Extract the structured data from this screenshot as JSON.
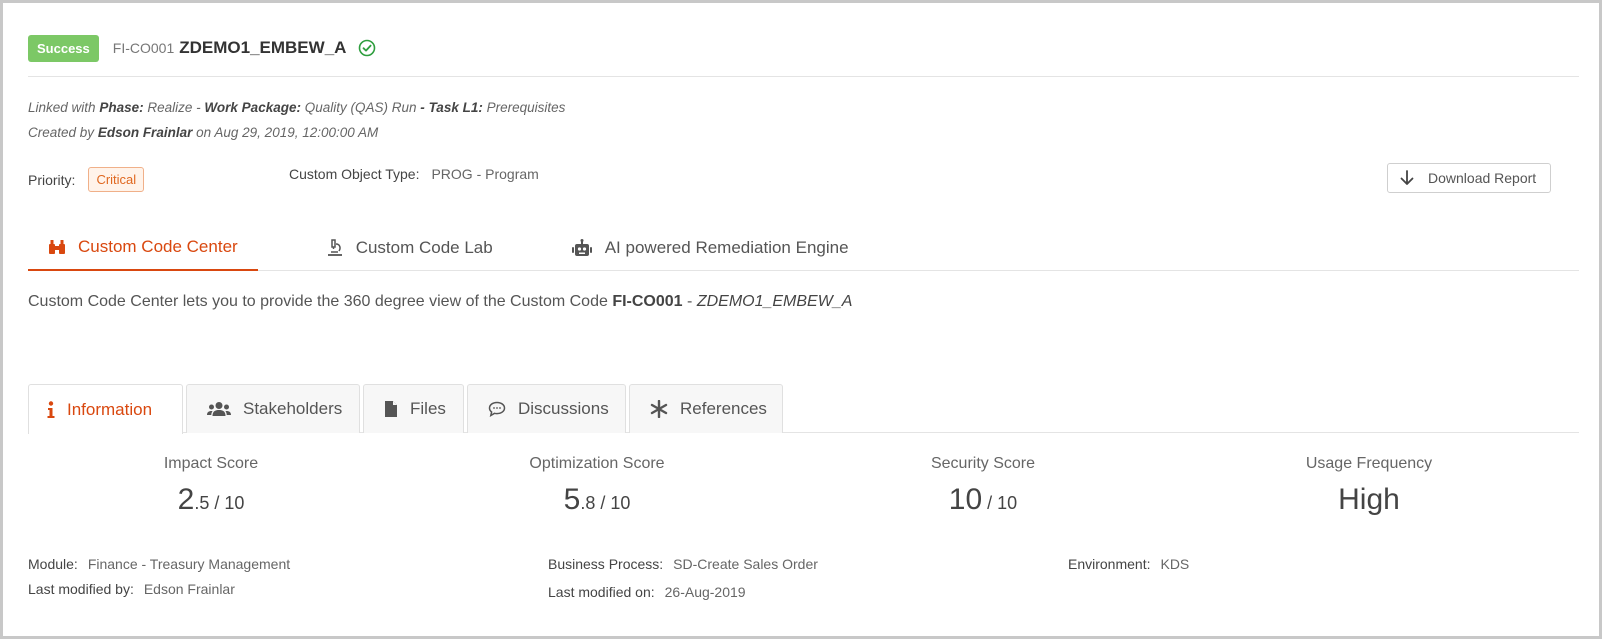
{
  "header": {
    "status": "Success",
    "object_id": "FI-CO001",
    "object_name": "ZDEMO1_EMBEW_A",
    "status_icon": "check-circle-icon"
  },
  "meta": {
    "linked_prefix": "Linked with",
    "phase_label": "Phase:",
    "phase_value": "Realize",
    "sep1": "-",
    "work_package_label": "Work Package:",
    "work_package_value": "Quality (QAS) Run",
    "sep2": "-",
    "task_label": "Task L1:",
    "task_value": "Prerequisites",
    "created_prefix": "Created by",
    "created_by": "Edson Frainlar",
    "created_on_prefix": "on",
    "created_on": "Aug 29, 2019, 12:00:00 AM"
  },
  "priority": {
    "label": "Priority:",
    "value": "Critical"
  },
  "custom_object_type": {
    "label": "Custom Object Type:",
    "value": "PROG - Program"
  },
  "download": {
    "label": "Download Report",
    "icon": "arrow-down-icon"
  },
  "main_tabs": [
    {
      "label": "Custom Code Center",
      "icon": "binoculars-icon",
      "active": true
    },
    {
      "label": "Custom Code Lab",
      "icon": "microscope-icon",
      "active": false
    },
    {
      "label": "AI powered Remediation Engine",
      "icon": "robot-icon",
      "active": false
    }
  ],
  "description": {
    "text": "Custom Code Center lets you to provide the 360 degree view of the Custom Code",
    "object_id": "FI-CO001",
    "sep": "-",
    "object_name": "ZDEMO1_EMBEW_A"
  },
  "sub_tabs": [
    {
      "label": "Information",
      "icon": "info-icon",
      "active": true
    },
    {
      "label": "Stakeholders",
      "icon": "users-icon",
      "active": false
    },
    {
      "label": "Files",
      "icon": "file-icon",
      "active": false
    },
    {
      "label": "Discussions",
      "icon": "comment-icon",
      "active": false
    },
    {
      "label": "References",
      "icon": "asterisk-icon",
      "active": false
    }
  ],
  "scores": [
    {
      "label": "Impact Score",
      "major": "2",
      "minor": ".5 / 10"
    },
    {
      "label": "Optimization Score",
      "major": "5",
      "minor": ".8 / 10"
    },
    {
      "label": "Security Score",
      "major": "10",
      "minor": " / 10"
    },
    {
      "label": "Usage Frequency",
      "major": "High",
      "minor": ""
    }
  ],
  "fields": {
    "module": {
      "label": "Module:",
      "value": "Finance - Treasury Management"
    },
    "last_modified_by": {
      "label": "Last modified by:",
      "value": "Edson Frainlar"
    },
    "business_process": {
      "label": "Business Process:",
      "value": "SD-Create Sales Order"
    },
    "last_modified_on": {
      "label": "Last modified on:",
      "value": "26-Aug-2019"
    },
    "environment": {
      "label": "Environment:",
      "value": "KDS"
    }
  },
  "colors": {
    "accent": "#d9480f",
    "success": "#7cc866",
    "check": "#2e9e3e"
  }
}
